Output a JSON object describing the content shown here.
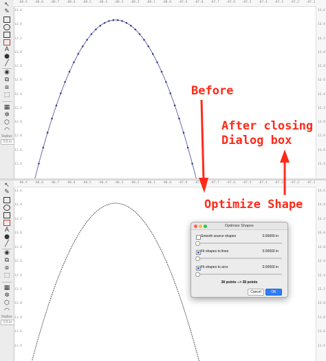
{
  "annotations": {
    "before": "Before",
    "after_line1": "After closing",
    "after_line2": "Dialog box",
    "optimize": "Optimize Shape",
    "color": "#ff2a1a"
  },
  "toolbar": {
    "label_top": "Radius",
    "value_top": "0.5 in",
    "label_bottom": "Radius",
    "value_bottom": "0.5 in"
  },
  "rulers": {
    "top_ticks": [
      "-88.9",
      "-88.8",
      "-88.7",
      "-88.6",
      "-88.5",
      "-88.4",
      "-88.3",
      "-88.2",
      "-88.1",
      "-88.0",
      "-87.9",
      "-87.8",
      "-87.7",
      "-87.6",
      "-87.5",
      "-87.4",
      "-87.3",
      "-87.2",
      "-87.1"
    ],
    "bottom_ticks": [
      "-88.9",
      "-88.8",
      "-88.7",
      "-88.6",
      "-88.5",
      "-88.4",
      "-88.3",
      "-88.2",
      "-88.1",
      "-88.0",
      "-87.9",
      "-87.8",
      "-87.7",
      "-87.6",
      "-87.5",
      "-87.4",
      "-87.3",
      "-87.2",
      "-87.1"
    ],
    "right_ticks": [
      "13.6",
      "13.4",
      "13.2",
      "13.0",
      "12.8",
      "12.6",
      "12.4",
      "12.2",
      "12.0",
      "11.8",
      "11.6",
      "11.4"
    ]
  },
  "dialog": {
    "title": "Optimize Shapes",
    "options": [
      {
        "label": "Smooth source shapes",
        "value": "0.00000 in",
        "checked": false
      },
      {
        "label": "Fit shapes to lines",
        "value": "0.00000 in",
        "checked": true
      },
      {
        "label": "Fit shapes to arcs",
        "value": "0.00000 in",
        "checked": true
      }
    ],
    "points_summary": "38 points --> 38 points",
    "cancel_label": "Cancel",
    "ok_label": "OK"
  },
  "curve": {
    "stroke_color": "#5a5aa0",
    "node_color": "#3b3b8f"
  }
}
